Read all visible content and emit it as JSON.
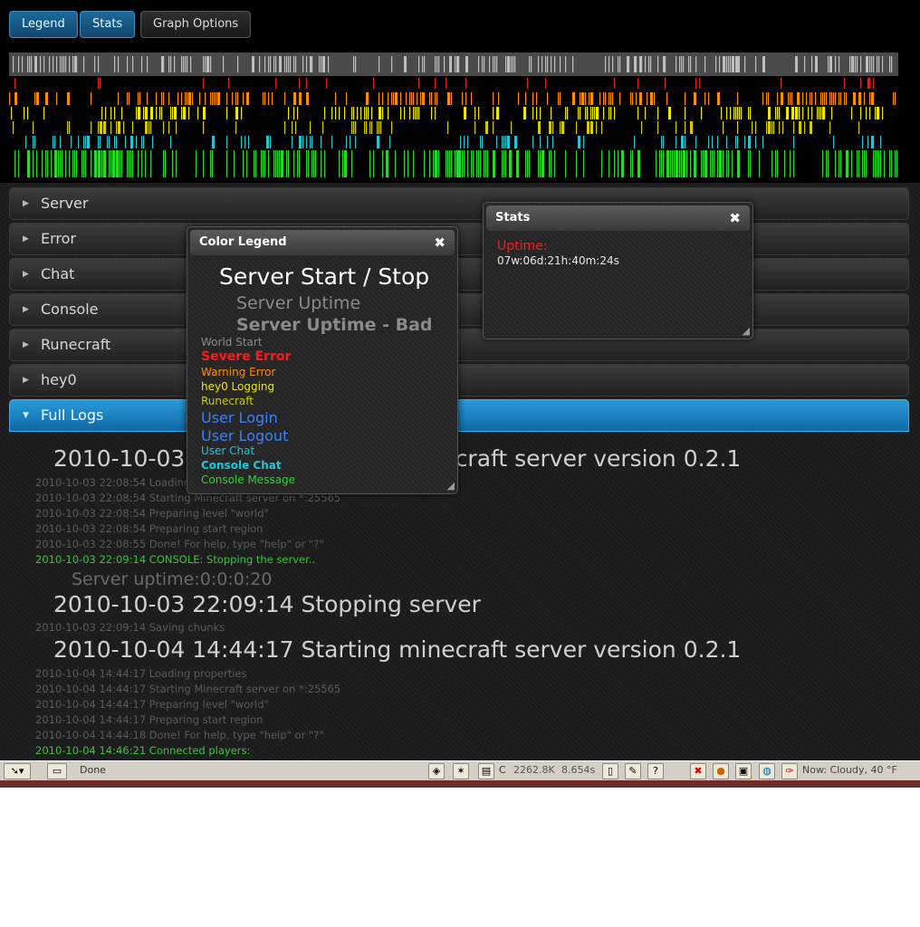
{
  "toolbar": {
    "legend_label": "Legend",
    "stats_label": "Stats",
    "graph_options_label": "Graph Options"
  },
  "accordions": [
    {
      "label": "Server",
      "open": false
    },
    {
      "label": "Error",
      "open": false
    },
    {
      "label": "Chat",
      "open": false
    },
    {
      "label": "Console",
      "open": false
    },
    {
      "label": "Runecraft",
      "open": false
    },
    {
      "label": "hey0",
      "open": false
    },
    {
      "label": "Full Logs",
      "open": true
    }
  ],
  "timeline_colors": {
    "row1": "#bdbdbd",
    "row2": "#e21c1c",
    "row3": "#ff8c00",
    "row4": "#f2e600",
    "row5": "#d8c800",
    "row6": "#23c4d4",
    "row7": "#2bd62b"
  },
  "logs": {
    "start1": "2010-10-03 22:08:54 Starting minecraft server version 0.2.1",
    "lines1": [
      {
        "text": "2010-10-03 22:08:54 Loading properties",
        "console": false
      },
      {
        "text": "2010-10-03 22:08:54 Starting Minecraft server on *:25565",
        "console": false
      },
      {
        "text": "2010-10-03 22:08:54 Preparing level \"world\"",
        "console": false
      },
      {
        "text": "2010-10-03 22:08:54 Preparing start region",
        "console": false
      },
      {
        "text": "2010-10-03 22:08:55 Done! For help, type \"help\" or \"?\"",
        "console": false
      },
      {
        "text": "2010-10-03 22:09:14 CONSOLE: Stopping the server..",
        "console": true
      }
    ],
    "uptime": "Server uptime:0:0:0:20",
    "stop1": "2010-10-03 22:09:14 Stopping server",
    "saving": "2010-10-03 22:09:14 Saving chunks",
    "start2": "2010-10-04 14:44:17 Starting minecraft server version 0.2.1",
    "lines2": [
      {
        "text": "2010-10-04 14:44:17 Loading properties",
        "console": false
      },
      {
        "text": "2010-10-04 14:44:17 Starting Minecraft server on *:25565",
        "console": false
      },
      {
        "text": "2010-10-04 14:44:17 Preparing level \"world\"",
        "console": false
      },
      {
        "text": "2010-10-04 14:44:17 Preparing start region",
        "console": false
      },
      {
        "text": "2010-10-04 14:44:18 Done! For help, type \"help\" or \"?\"",
        "console": false
      },
      {
        "text": "2010-10-04 14:46:21 Connected players:",
        "console": true
      }
    ]
  },
  "legend_dialog": {
    "title": "Color Legend",
    "close": "✖",
    "items": {
      "server_start_stop": "Server Start / Stop",
      "server_uptime": "Server Uptime",
      "server_uptime_bad": "Server Uptime - Bad",
      "world_start": "World Start",
      "severe_error": "Severe Error",
      "warning_error": "Warning Error",
      "hey0_logging": "hey0 Logging",
      "runecraft": "Runecraft",
      "user_login": "User Login",
      "user_logout": "User Logout",
      "user_chat": "User Chat",
      "console_chat": "Console Chat",
      "console_message": "Console Message"
    },
    "colors": {
      "severe_error": "#ff1a1a",
      "warning_error": "#ff8c00",
      "hey0_logging": "#f2e600",
      "runecraft": "#c8c800",
      "user_login": "#3b7fff",
      "user_chat": "#23c4d4",
      "console_message": "#2bd62b"
    }
  },
  "stats_dialog": {
    "title": "Stats",
    "close": "✖",
    "uptime_label": "Uptime:",
    "uptime_value": "07w:06d:21h:40m:24s"
  },
  "taskbar": {
    "status": "Done",
    "c_label": "C",
    "mem": "2262.8K",
    "time": "8.654s",
    "weather": "Now: Cloudy, 40 °F"
  }
}
